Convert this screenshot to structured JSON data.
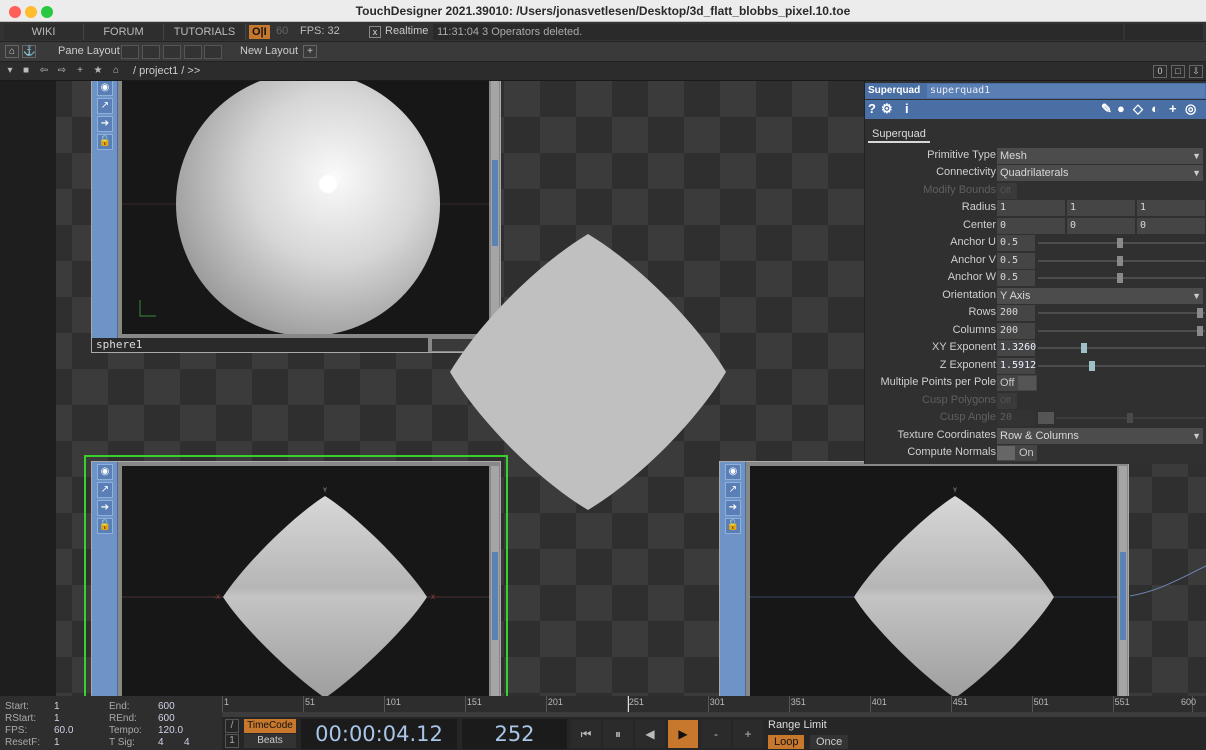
{
  "window": {
    "title": "TouchDesigner 2021.39010: /Users/jonasvetlesen/Desktop/3d_flatt_blobbs_pixel.10.toe"
  },
  "menubar": {
    "wiki": "WIKI",
    "forum": "FORUM",
    "tutorials": "TUTORIALS",
    "oi": "O|I",
    "fps_cap": "60",
    "fps_label": "FPS:  32",
    "realtime_check": "x",
    "realtime": "Realtime",
    "status": "11:31:04 3 Operators deleted."
  },
  "panebar": {
    "pane_layout": "Pane Layout",
    "new_layout": "New Layout",
    "add": "+"
  },
  "pathbar": {
    "path": "/ project1 / >>",
    "level": "0"
  },
  "nodes": {
    "sphere_name": "sphere1",
    "axis_y": "Y",
    "axis_x": "X",
    "axis_minus_x": "-X"
  },
  "params": {
    "op_type": "Superquad",
    "op_name": "superquad1",
    "tab": "Superquad",
    "primitive_type": {
      "label": "Primitive Type",
      "value": "Mesh"
    },
    "connectivity": {
      "label": "Connectivity",
      "value": "Quadrilaterals"
    },
    "modify_bounds": {
      "label": "Modify Bounds",
      "value": "Off"
    },
    "radius": {
      "label": "Radius",
      "x": "1",
      "y": "1",
      "z": "1"
    },
    "center": {
      "label": "Center",
      "x": "0",
      "y": "0",
      "z": "0"
    },
    "anchor_u": {
      "label": "Anchor U",
      "value": "0.5",
      "fraction": 0.5
    },
    "anchor_v": {
      "label": "Anchor V",
      "value": "0.5",
      "fraction": 0.5
    },
    "anchor_w": {
      "label": "Anchor W",
      "value": "0.5",
      "fraction": 0.5
    },
    "orientation": {
      "label": "Orientation",
      "value": "Y Axis"
    },
    "rows": {
      "label": "Rows",
      "value": "200"
    },
    "columns": {
      "label": "Columns",
      "value": "200"
    },
    "xy_exponent": {
      "label": "XY Exponent",
      "value": "1.3260"
    },
    "z_exponent": {
      "label": "Z Exponent",
      "value": "1.5912"
    },
    "multiple_points": {
      "label": "Multiple Points per Pole",
      "value": "Off"
    },
    "cusp_polygons": {
      "label": "Cusp Polygons",
      "value": "Off"
    },
    "cusp_angle": {
      "label": "Cusp Angle",
      "value": "20"
    },
    "texture_coords": {
      "label": "Texture Coordinates",
      "value": "Row & Columns"
    },
    "compute_normals": {
      "label": "Compute Normals",
      "value": "On"
    }
  },
  "timeline": {
    "start_l": "Start:",
    "start_v": "1",
    "end_l": "End:",
    "end_v": "600",
    "rstart_l": "RStart:",
    "rstart_v": "1",
    "rend_l": "REnd:",
    "rend_v": "600",
    "fps_l": "FPS:",
    "fps_v": "60.0",
    "tempo_l": "Tempo:",
    "tempo_v": "120.0",
    "resetf_l": "ResetF:",
    "resetf_v": "1",
    "tsig_l": "T Sig:",
    "tsig_a": "4",
    "tsig_b": "4",
    "ticks": [
      "1",
      "51",
      "101",
      "151",
      "201",
      "251",
      "301",
      "351",
      "401",
      "451",
      "501",
      "551",
      "600"
    ],
    "timecode": "TimeCode",
    "beats": "Beats",
    "slash": "/",
    "i": "1",
    "time": "00:00:04.12",
    "frame": "252",
    "range_limit": "Range Limit",
    "loop": "Loop",
    "once": "Once",
    "btn_start": "⏮",
    "btn_pause": "⏸",
    "btn_back": "◀",
    "btn_play": "▶",
    "btn_minus": "-",
    "btn_plus": "+"
  },
  "colors": {
    "accent": "#c8782c",
    "node_strip": "#6e93c6",
    "selected_outline": "#39d12b",
    "param_header": "#4a6fa5"
  }
}
